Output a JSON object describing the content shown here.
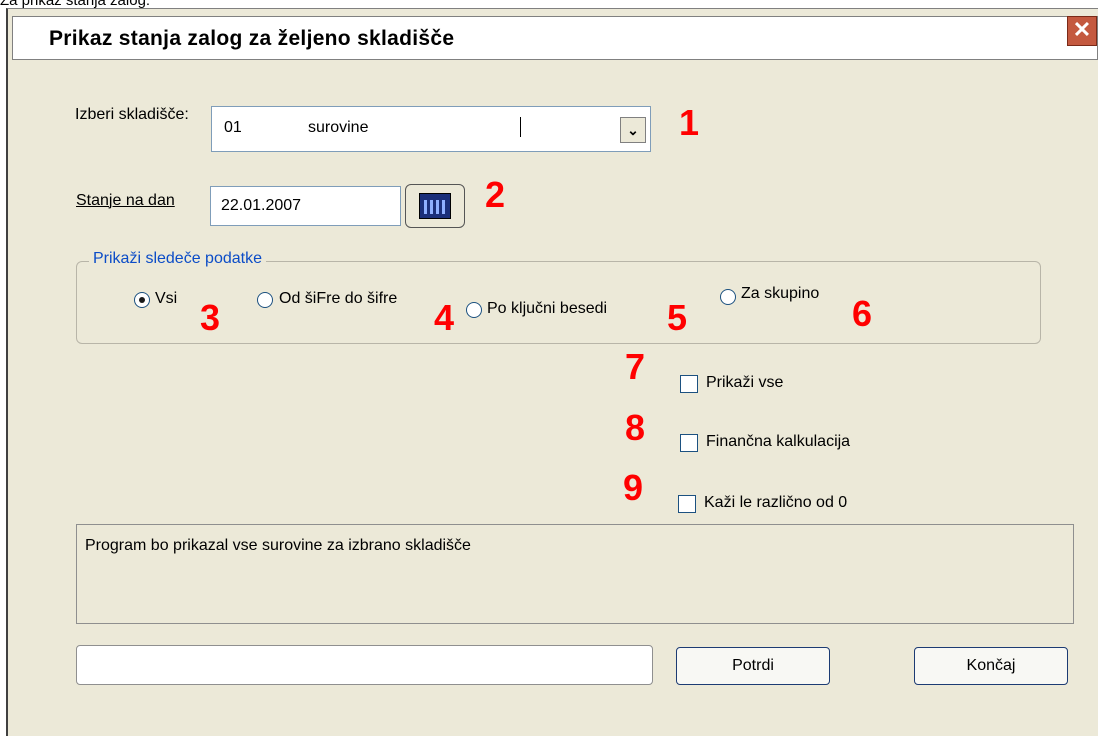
{
  "top_caption": "Za prikaz stanja zalog:",
  "window": {
    "title": "Prikaz stanja zalog za željeno skladišče",
    "close_glyph": "✕"
  },
  "warehouse": {
    "label": "Izberi skladišče:",
    "code": "01",
    "name": "surovine",
    "dropdown_glyph": "⌄"
  },
  "date": {
    "label": "Stanje na dan",
    "value": "22.01.2007",
    "icon": "calendar-icon"
  },
  "filter": {
    "title": "Prikaži sledeče podatke",
    "options": [
      {
        "label": "Vsi",
        "selected": true,
        "marker": "3"
      },
      {
        "label": "Od šiFre do šifre",
        "selected": false,
        "marker": "4"
      },
      {
        "label": "Po ključni besedi",
        "selected": false,
        "marker": "5"
      },
      {
        "label": "Za skupino",
        "selected": false,
        "marker": "6"
      }
    ]
  },
  "checkboxes": [
    {
      "label": "Prikaži vse",
      "checked": false,
      "marker": "7"
    },
    {
      "label": "Finančna kalkulacija",
      "checked": false,
      "marker": "8"
    },
    {
      "label": "Kaži le različno od 0",
      "checked": false,
      "marker": "9"
    }
  ],
  "markers": {
    "warehouse": "1",
    "date": "2"
  },
  "info_text": "Program bo prikazal vse surovine za izbrano skladišče",
  "buttons": {
    "confirm": "Potrdi",
    "close": "Končaj"
  },
  "colors": {
    "marker": "#ff0000",
    "group_title": "#0b4cc7",
    "dialog_bg": "#ece9d8"
  }
}
